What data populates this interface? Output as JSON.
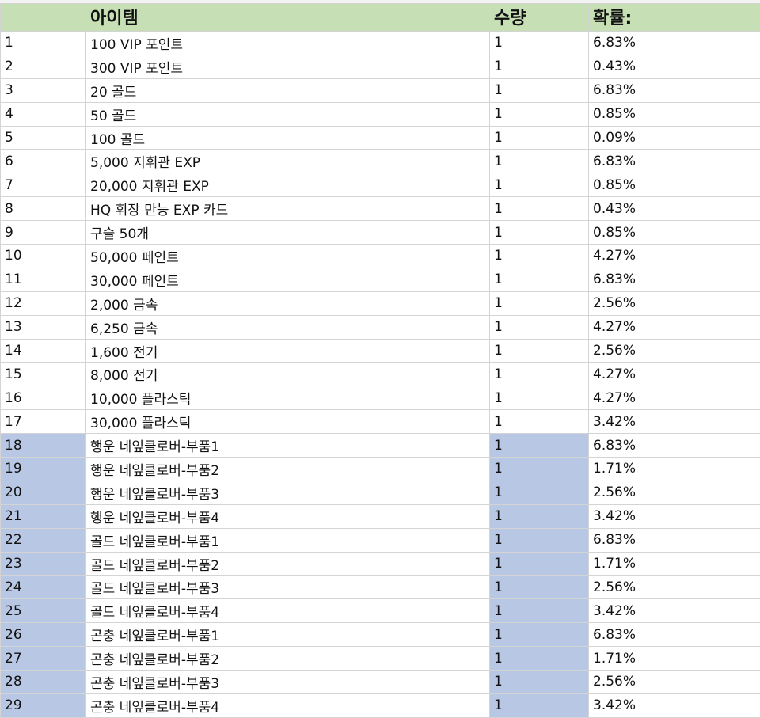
{
  "header": {
    "col_num": "",
    "col_item": "아이템",
    "col_qty": "수량",
    "col_prob": "확률:"
  },
  "rows": [
    {
      "num": "1",
      "item": "100 VIP 포인트",
      "qty": "1",
      "prob": "6.83%",
      "shaded": false
    },
    {
      "num": "2",
      "item": "300 VIP 포인트",
      "qty": "1",
      "prob": "0.43%",
      "shaded": false
    },
    {
      "num": "3",
      "item": "20 골드",
      "qty": "1",
      "prob": "6.83%",
      "shaded": false
    },
    {
      "num": "4",
      "item": "50 골드",
      "qty": "1",
      "prob": "0.85%",
      "shaded": false
    },
    {
      "num": "5",
      "item": "100 골드",
      "qty": "1",
      "prob": "0.09%",
      "shaded": false
    },
    {
      "num": "6",
      "item": "5,000 지휘관 EXP",
      "qty": "1",
      "prob": "6.83%",
      "shaded": false
    },
    {
      "num": "7",
      "item": "20,000 지휘관 EXP",
      "qty": "1",
      "prob": "0.85%",
      "shaded": false
    },
    {
      "num": "8",
      "item": "HQ 휘장 만능 EXP 카드",
      "qty": "1",
      "prob": "0.43%",
      "shaded": false
    },
    {
      "num": "9",
      "item": "구슬 50개",
      "qty": "1",
      "prob": "0.85%",
      "shaded": false
    },
    {
      "num": "10",
      "item": "50,000 페인트",
      "qty": "1",
      "prob": "4.27%",
      "shaded": false
    },
    {
      "num": "11",
      "item": "30,000 페인트",
      "qty": "1",
      "prob": "6.83%",
      "shaded": false
    },
    {
      "num": "12",
      "item": "2,000 금속",
      "qty": "1",
      "prob": "2.56%",
      "shaded": false
    },
    {
      "num": "13",
      "item": "6,250 금속",
      "qty": "1",
      "prob": "4.27%",
      "shaded": false
    },
    {
      "num": "14",
      "item": "1,600 전기",
      "qty": "1",
      "prob": "2.56%",
      "shaded": false
    },
    {
      "num": "15",
      "item": "8,000 전기",
      "qty": "1",
      "prob": "4.27%",
      "shaded": false
    },
    {
      "num": "16",
      "item": "10,000 플라스틱",
      "qty": "1",
      "prob": "4.27%",
      "shaded": false
    },
    {
      "num": "17",
      "item": "30,000 플라스틱",
      "qty": "1",
      "prob": "3.42%",
      "shaded": false
    },
    {
      "num": "18",
      "item": "행운 네잎클로버-부품1",
      "qty": "1",
      "prob": "6.83%",
      "shaded": true
    },
    {
      "num": "19",
      "item": "행운 네잎클로버-부품2",
      "qty": "1",
      "prob": "1.71%",
      "shaded": true
    },
    {
      "num": "20",
      "item": "행운 네잎클로버-부품3",
      "qty": "1",
      "prob": "2.56%",
      "shaded": true
    },
    {
      "num": "21",
      "item": "행운 네잎클로버-부품4",
      "qty": "1",
      "prob": "3.42%",
      "shaded": true
    },
    {
      "num": "22",
      "item": "골드 네잎클로버-부품1",
      "qty": "1",
      "prob": "6.83%",
      "shaded": true
    },
    {
      "num": "23",
      "item": "골드 네잎클로버-부품2",
      "qty": "1",
      "prob": "1.71%",
      "shaded": true
    },
    {
      "num": "24",
      "item": "골드 네잎클로버-부품3",
      "qty": "1",
      "prob": "2.56%",
      "shaded": true
    },
    {
      "num": "25",
      "item": "골드 네잎클로버-부품4",
      "qty": "1",
      "prob": "3.42%",
      "shaded": true
    },
    {
      "num": "26",
      "item": "곤충 네잎클로버-부품1",
      "qty": "1",
      "prob": "6.83%",
      "shaded": true
    },
    {
      "num": "27",
      "item": "곤충 네잎클로버-부품2",
      "qty": "1",
      "prob": "1.71%",
      "shaded": true
    },
    {
      "num": "28",
      "item": "곤충 네잎클로버-부품3",
      "qty": "1",
      "prob": "2.56%",
      "shaded": true
    },
    {
      "num": "29",
      "item": "곤충 네잎클로버-부품4",
      "qty": "1",
      "prob": "3.42%",
      "shaded": true
    }
  ],
  "colors": {
    "header_fill": "#c6dfb4",
    "shaded_fill": "#b8c7e4",
    "gridline": "#d4d4d4"
  }
}
